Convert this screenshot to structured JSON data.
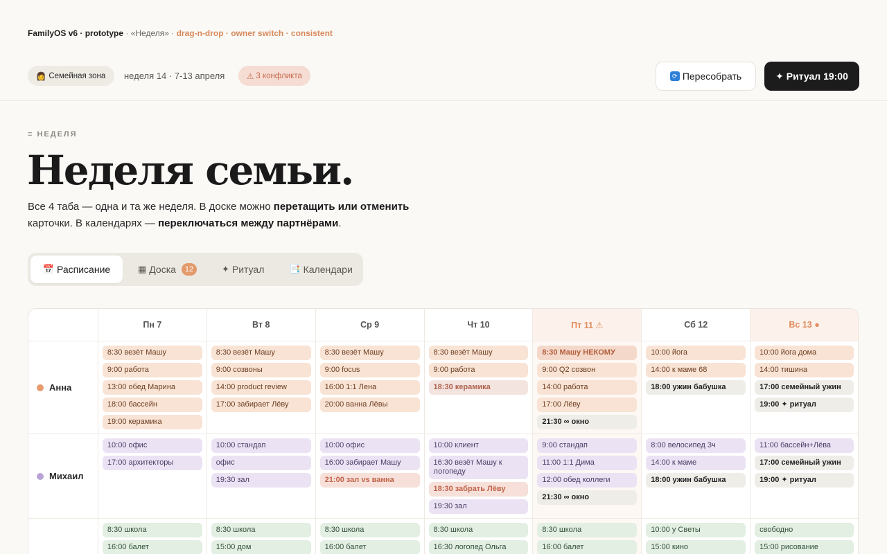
{
  "proto": {
    "app": "FamilyOS v6 · prototype",
    "sep": " · ",
    "tab": "«Неделя»",
    "features": "drag-n-drop · owner switch · consistent"
  },
  "topbar": {
    "zone_label": "Семейная зона",
    "zone_icon": "person-icon",
    "week": "неделя 14 · 7-13 апреля",
    "conflicts": "3 конфликта",
    "rebuild": "Пересобрать",
    "ritual": "✦ Ритуал 19:00"
  },
  "hero": {
    "eyebrow": "≡ НЕДЕЛЯ",
    "title": "Неделя семьи.",
    "lead_1": "Все 4 таба — одна и та же неделя. В доске можно ",
    "lead_b1": "перетащить или отменить",
    "lead_2": " карточки. В календарях — ",
    "lead_b2": "переключаться между партнёрами",
    "lead_3": "."
  },
  "tabs": [
    {
      "icon": "📅",
      "label": "Расписание"
    },
    {
      "icon": "▦",
      "label": "Доска",
      "badge": "12"
    },
    {
      "icon": "✦",
      "label": "Ритуал"
    },
    {
      "icon": "📑",
      "label": "Календари"
    }
  ],
  "days": [
    "Пн 7",
    "Вт 8",
    "Ср 9",
    "Чт 10",
    "Пт 11 ⚠",
    "Сб 12",
    "Вс 13 ●"
  ],
  "colors": {
    "anna": "#e99a6f",
    "mikhail": "#b9a2d6",
    "warn": "#e08c5f"
  },
  "people": [
    {
      "name": "Анна",
      "kind": "anna",
      "days": [
        [
          [
            "anna",
            "8:30 везёт Машу"
          ],
          [
            "anna",
            "9:00 работа"
          ],
          [
            "anna",
            "13:00 обед Марина"
          ],
          [
            "anna",
            "18:00 бассейн"
          ],
          [
            "anna",
            "19:00 керамика"
          ]
        ],
        [
          [
            "anna",
            "8:30 везёт Машу"
          ],
          [
            "anna",
            "9:00 созвоны"
          ],
          [
            "anna",
            "14:00 product review"
          ],
          [
            "anna",
            "17:00 забирает Лёву"
          ]
        ],
        [
          [
            "anna",
            "8:30 везёт Машу"
          ],
          [
            "anna",
            "9:00 focus"
          ],
          [
            "anna",
            "16:00 1:1 Лена"
          ],
          [
            "anna",
            "20:00 ванна Лёвы"
          ]
        ],
        [
          [
            "anna",
            "8:30 везёт Машу"
          ],
          [
            "anna",
            "9:00 работа"
          ],
          [
            "conflict-soft",
            "18:30 керамика"
          ]
        ],
        [
          [
            "nobody",
            "8:30 Машу НЕКОМУ"
          ],
          [
            "anna",
            "9:00 Q2 созвон"
          ],
          [
            "anna",
            "14:00 работа"
          ],
          [
            "anna",
            "17:00 Лёву"
          ],
          [
            "shared",
            "21:30 ∞ окно"
          ]
        ],
        [
          [
            "anna",
            "10:00 йога"
          ],
          [
            "anna",
            "14:00 к маме 68"
          ],
          [
            "shared",
            "18:00 ужин бабушка"
          ]
        ],
        [
          [
            "anna",
            "10:00 йога дома"
          ],
          [
            "anna",
            "14:00 тишина"
          ],
          [
            "shared",
            "17:00 семейный ужин"
          ],
          [
            "shared",
            "19:00 ✦ ритуал"
          ]
        ]
      ]
    },
    {
      "name": "Михаил",
      "kind": "mikh",
      "days": [
        [
          [
            "mikh",
            "10:00 офис"
          ],
          [
            "mikh",
            "17:00 архитекторы"
          ]
        ],
        [
          [
            "mikh",
            "10:00 стандап"
          ],
          [
            "mikh",
            "офис"
          ],
          [
            "mikh",
            "19:30 зал"
          ]
        ],
        [
          [
            "mikh",
            "10:00 офис"
          ],
          [
            "mikh",
            "16:00 забирает Машу"
          ],
          [
            "conflict",
            "21:00 зал vs ванна"
          ]
        ],
        [
          [
            "mikh",
            "10:00 клиент"
          ],
          [
            "mikh",
            "16:30 везёт Машу к логопеду"
          ],
          [
            "conflict",
            "18:30 забрать Лёву"
          ],
          [
            "mikh",
            "19:30 зал"
          ]
        ],
        [
          [
            "mikh",
            "9:00 стандап"
          ],
          [
            "mikh",
            "11:00 1:1 Дима"
          ],
          [
            "mikh",
            "12:00 обед коллеги"
          ],
          [
            "shared",
            "21:30 ∞ окно"
          ]
        ],
        [
          [
            "mikh",
            "8:00 велосипед 3ч"
          ],
          [
            "mikh",
            "14:00 к маме"
          ],
          [
            "shared",
            "18:00 ужин бабушка"
          ]
        ],
        [
          [
            "mikh",
            "11:00 бассейн+Лёва"
          ],
          [
            "shared",
            "17:00 семейный ужин"
          ],
          [
            "shared",
            "19:00 ✦ ритуал"
          ]
        ]
      ]
    },
    {
      "name": "",
      "kind": "kid",
      "days": [
        [
          [
            "kid",
            "8:30 школа"
          ],
          [
            "kid",
            "16:00 балет"
          ]
        ],
        [
          [
            "kid",
            "8:30 школа"
          ],
          [
            "kid",
            "15:00 дом"
          ]
        ],
        [
          [
            "kid",
            "8:30 школа"
          ],
          [
            "kid",
            "16:00 балет"
          ]
        ],
        [
          [
            "kid",
            "8:30 школа"
          ],
          [
            "kid",
            "16:30 логопед Ольга"
          ]
        ],
        [
          [
            "kid",
            "8:30 школа"
          ],
          [
            "kid",
            "16:00 балет"
          ]
        ],
        [
          [
            "kid",
            "10:00 у Светы"
          ],
          [
            "kid",
            "15:00 кино"
          ]
        ],
        [
          [
            "kid",
            "свободно"
          ],
          [
            "kid",
            "15:00 рисование"
          ]
        ]
      ]
    }
  ]
}
